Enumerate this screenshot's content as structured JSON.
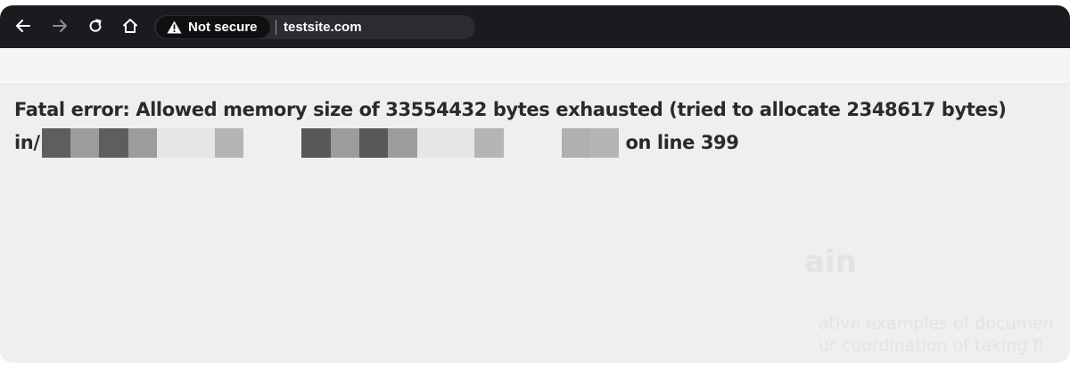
{
  "toolbar": {
    "back_icon": "arrow-left-icon",
    "forward_icon": "arrow-right-icon",
    "reload_icon": "reload-icon",
    "home_icon": "home-icon",
    "security_icon": "warning-triangle-icon",
    "security_label": "Not secure",
    "url": "testsite.com"
  },
  "error": {
    "line1": "Fatal error: Allowed memory size of 33554432 bytes exhausted (tried to allocate 2348617 bytes)",
    "prefix": "in/",
    "suffix": "on line 399",
    "redacted_colors": [
      "#5e5e5e",
      "#9c9c9c",
      "#5e5e5e",
      "#9c9c9c",
      "#e6e6e6",
      "#e6e6e6",
      "#b5b5b5",
      "#efeff1",
      "#f0f0f0",
      "#585858",
      "#9c9c9c",
      "#585858",
      "#9c9c9c",
      "#e6e6e6",
      "#e6e6e6",
      "#b5b5b5",
      "#efeff1",
      "#f0f0f0",
      "#b0b0b0",
      "#b5b5b5"
    ]
  },
  "background_ghost": {
    "heading": "ain",
    "line1": "ative examples of documen",
    "line2": "ur coordination of taking fl"
  }
}
